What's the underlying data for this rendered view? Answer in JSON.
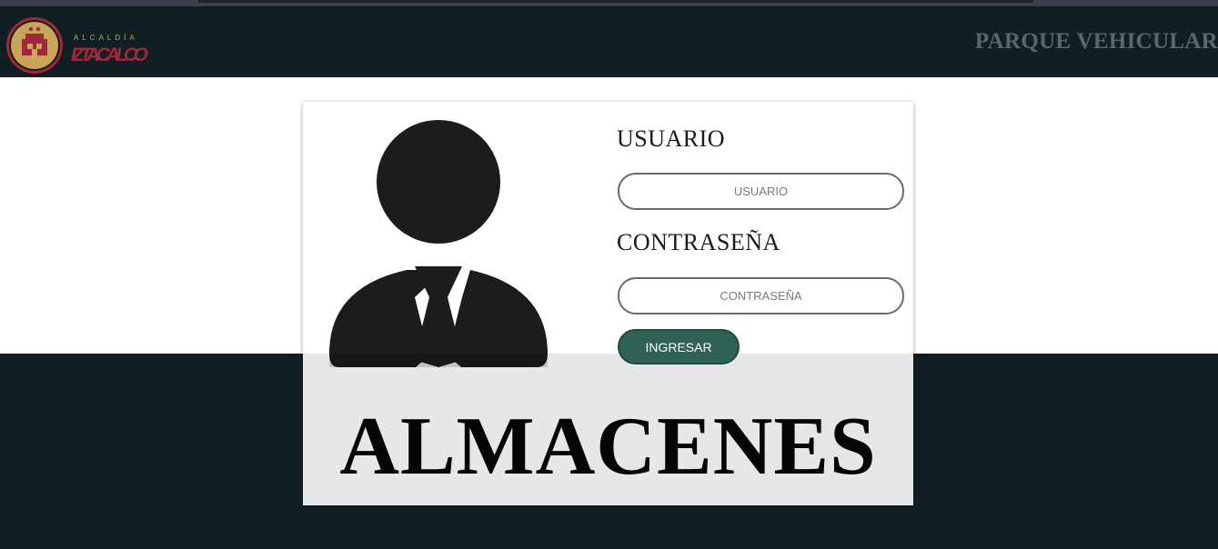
{
  "header": {
    "logo": {
      "icon": "iztacalco-seal-icon",
      "line1": "ALCALDÍA",
      "line2": "IZTACALCO",
      "colors": {
        "seal_ring": "#a0283c",
        "seal_fill": "#c9a55a",
        "text": "#a0283c",
        "small_text": "#c9a55a"
      }
    },
    "title": "PARQUE VEHICULAR"
  },
  "login": {
    "avatar_icon": "user-silhouette-icon",
    "username_label": "USUARIO",
    "username_placeholder": "USUARIO",
    "username_value": "",
    "password_label": "CONTRASEÑA",
    "password_placeholder": "CONTRASEÑA",
    "password_value": "",
    "submit_label": "INGRESAR"
  },
  "heading": "ALMACENES",
  "colors": {
    "header_bg": "#111f22",
    "button_bg": "#2f6254",
    "card_lower_bg": "#e6e7e9"
  }
}
